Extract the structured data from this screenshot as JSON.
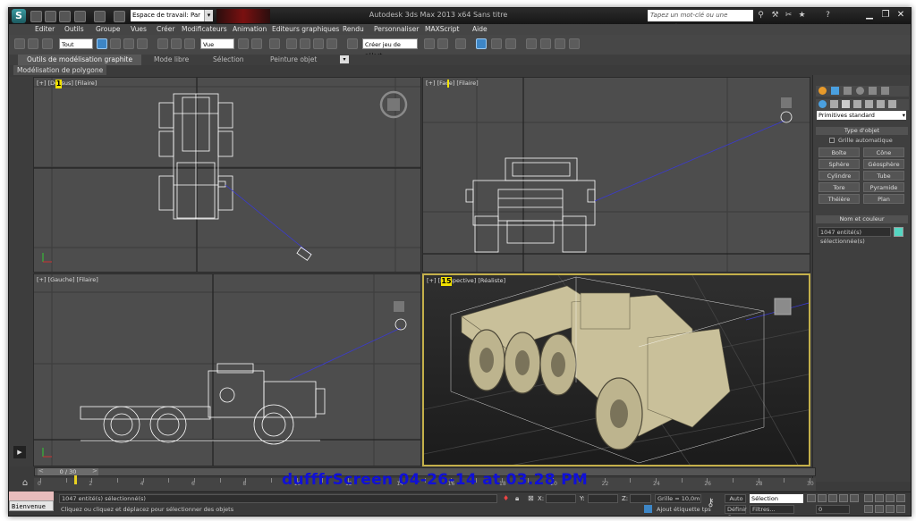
{
  "titlebar": {
    "logo_glyph": "S",
    "workspace_value": "Espace de travail: Par",
    "title": "Autodesk 3ds Max  2013 x64     Sans titre",
    "search_placeholder": "Tapez un mot-clé ou une expression"
  },
  "menu": [
    "Editer",
    "Outils",
    "Groupe",
    "Vues",
    "Créer",
    "Modificateurs",
    "Animation",
    "Editeurs graphiques",
    "Rendu",
    "Personnaliser",
    "MAXScript",
    "Aide"
  ],
  "toolbar": {
    "filter_select": "Tout",
    "refcoord_select": "Vue",
    "named_selection_placeholder": "Créer jeu de sélect"
  },
  "ribbon": {
    "tabs": [
      "Outils de modélisation graphite",
      "Mode libre",
      "Sélection",
      "Peinture objet"
    ],
    "sub_label": "Modélisation de polygone"
  },
  "viewports": {
    "top": {
      "label": "[+] [Dessus] [Filaire]",
      "num": "1"
    },
    "front": {
      "label": "[+] [Face] [Filaire]"
    },
    "left": {
      "label": "[+] [Gauche] [Filaire]"
    },
    "persp": {
      "label": "[+] [Perspective] [Réaliste]",
      "num": "15"
    }
  },
  "command_panel": {
    "dropdown": "Primitives standard",
    "object_type_title": "Type d'objet",
    "autogrid": "Grille automatique",
    "buttons": [
      "Boîte",
      "Cône",
      "Sphère",
      "Géosphère",
      "Cylindre",
      "Tube",
      "Tore",
      "Pyramide",
      "Théière",
      "Plan"
    ],
    "name_color_title": "Nom et couleur",
    "name_value": "1047 entité(s) sélectionnée(s)",
    "color": "#55d6c2"
  },
  "timeline": {
    "frame_label": "0 / 30",
    "ticks": [
      0,
      1,
      2,
      3,
      4,
      5,
      6,
      7,
      8,
      9,
      10,
      11,
      12,
      13,
      14,
      15,
      16,
      17,
      18,
      19,
      20,
      21,
      22,
      23,
      24,
      25,
      26,
      27,
      28,
      29,
      30
    ]
  },
  "status": {
    "selected": "1047 entité(s) sélectionné(s)",
    "prompt": "Cliquez ou cliquez et déplacez pour sélectionner des objets",
    "x_label": "X:",
    "y_label": "Y:",
    "z_label": "Z:",
    "grid": "Grille = 10,0m",
    "add_tag": "Ajout étiquette tps",
    "auto_label": "Auto",
    "set_key_label": "Définir C.",
    "selection_select": "Sélection",
    "filters_label": "Filtres...",
    "frame_value": "0",
    "welcome": "Bienvenue"
  },
  "watermark": "dufffrScreen 04-26-14 at 03.28 PM",
  "colors": {
    "active_viewport": "#c4b04a",
    "wire": "#ffffff",
    "truck_solid": "#c9c09a"
  }
}
